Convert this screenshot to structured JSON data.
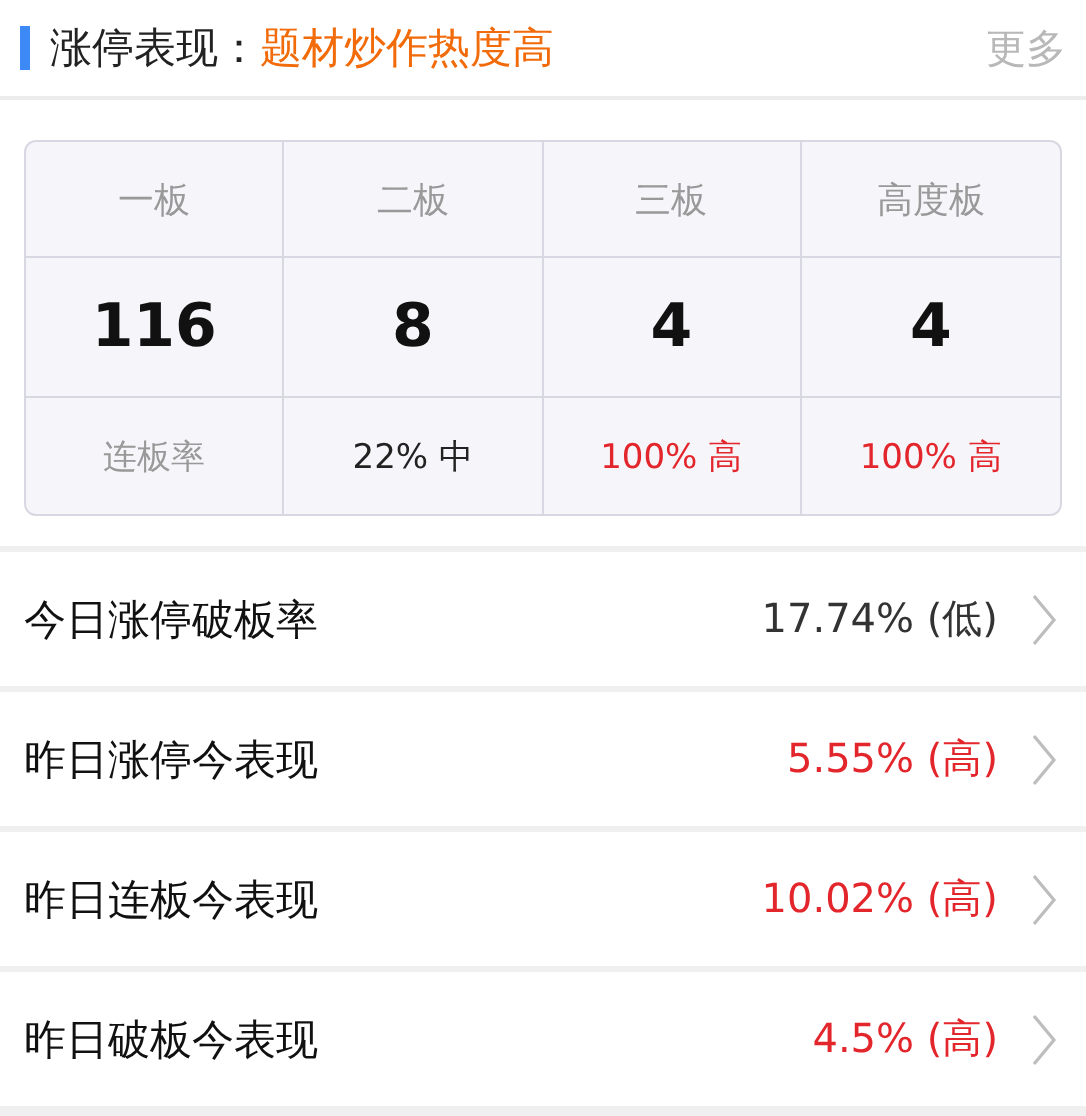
{
  "header": {
    "label": "涨停表现：",
    "highlight": "题材炒作热度高",
    "more": "更多"
  },
  "board": {
    "columns": [
      "一板",
      "二板",
      "三板",
      "高度板"
    ],
    "counts": [
      "116",
      "8",
      "4",
      "4"
    ],
    "rates": [
      {
        "text": "连板率",
        "color": "#999999"
      },
      {
        "text": "22% 中",
        "color": "#222222"
      },
      {
        "text": "100% 高",
        "color": "#e3262c"
      },
      {
        "text": "100% 高",
        "color": "#e3262c"
      }
    ]
  },
  "rows": [
    {
      "label": "今日涨停破板率",
      "value": "17.74% (低)",
      "color": "#333333"
    },
    {
      "label": "昨日涨停今表现",
      "value": "5.55% (高)",
      "color": "#e3262c"
    },
    {
      "label": "昨日连板今表现",
      "value": "10.02% (高)",
      "color": "#e3262c"
    },
    {
      "label": "昨日破板今表现",
      "value": "4.5% (高)",
      "color": "#e3262c"
    }
  ]
}
